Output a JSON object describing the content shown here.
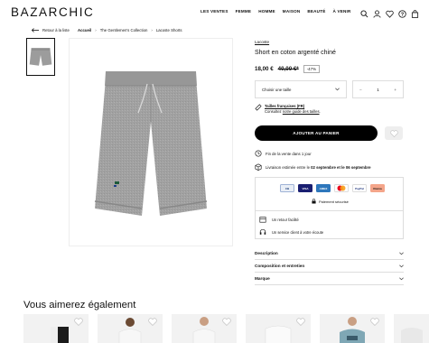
{
  "header": {
    "logo": "BAZARCHIC",
    "nav": [
      "LES VENTES",
      "FEMME",
      "HOMME",
      "MAISON",
      "BEAUTÉ",
      "À VENIR"
    ],
    "icons": [
      "search-icon",
      "user-icon",
      "heart-icon",
      "help-icon",
      "bag-icon"
    ]
  },
  "breadcrumb": {
    "back_label": "Retour à la liste",
    "items": [
      "Accueil",
      "The Gentlemen's Collection",
      "Lacoste Shorts"
    ]
  },
  "product": {
    "brand": "Lacoste",
    "title": "Short en coton argenté chiné",
    "price": "18,00 €",
    "old_price": "40,00 €*",
    "discount": "-47%",
    "size_placeholder": "Choisir une taille",
    "quantity": "1",
    "qty_minus": "−",
    "qty_plus": "+",
    "sizes_title": "Tailles françaises (FR)",
    "sizes_text_pre": "Consultez ",
    "sizes_text_link": "notre guide des tailles",
    "sizes_text_post": ".",
    "add_to_cart": "AJOUTER AU PANIER",
    "sale_end": "Fin de la vente dans 1 jour",
    "delivery_pre": "Livraison estimée entre le ",
    "delivery_bold": "02 septembre et le 06 septembre",
    "secure_payment": "Paiement sécurisé",
    "payment_logos": [
      "CB",
      "VISA",
      "AMEX",
      "MC",
      "PayPal",
      "Klarna"
    ],
    "services": [
      "Un retour facilité",
      "Un service client à votre écoute"
    ],
    "accordions": [
      "Description",
      "Composition et entretien",
      "Marque"
    ]
  },
  "recommendations": {
    "title": "Vous aimerez également"
  },
  "colors": {
    "accent": "#000000",
    "shorts": "#9c9c9c",
    "card_bg": "#f2f2f2"
  }
}
